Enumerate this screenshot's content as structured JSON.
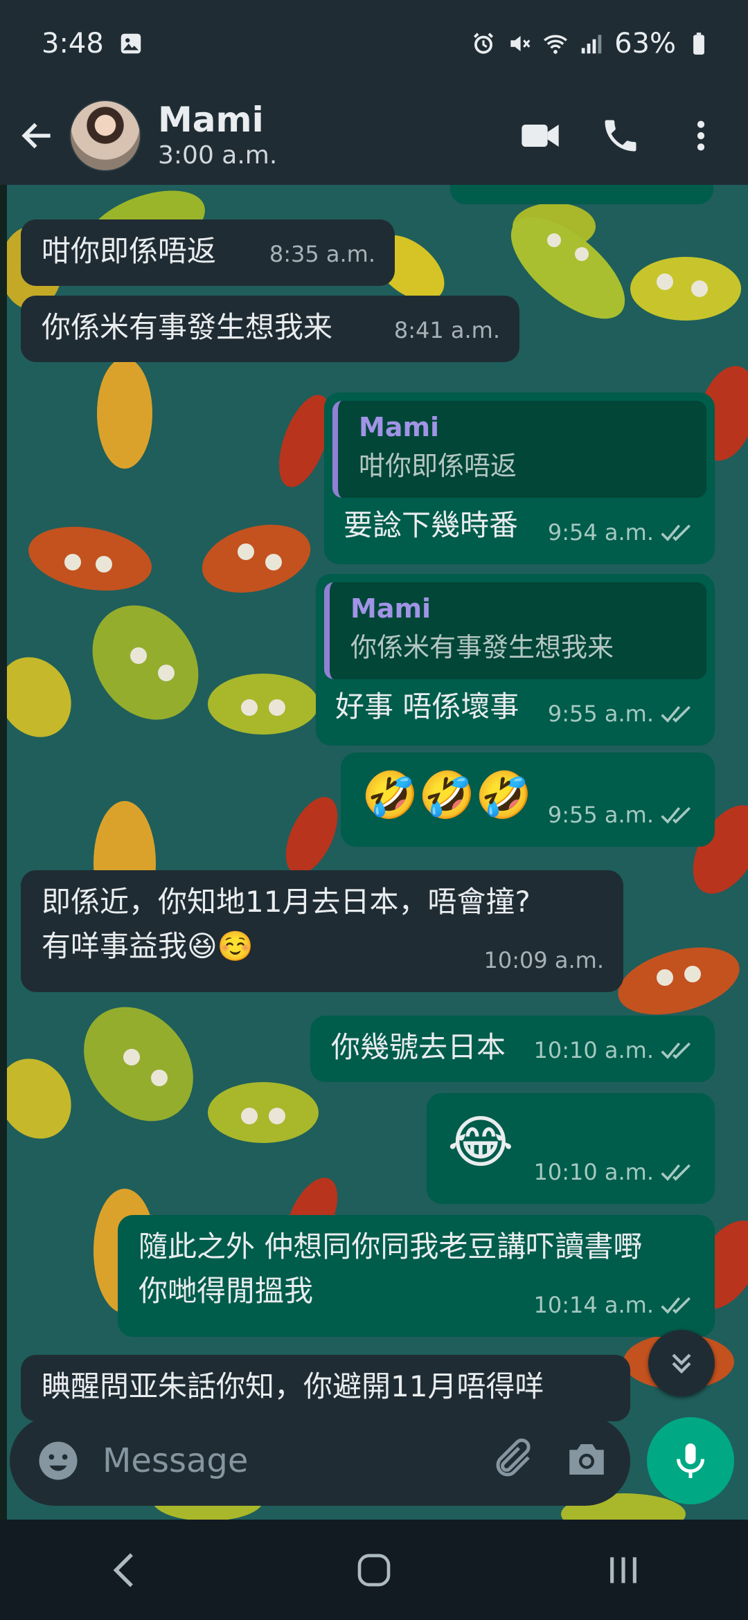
{
  "status_bar": {
    "time": "3:48",
    "battery": "63%"
  },
  "header": {
    "contact_name": "Mami",
    "last_seen": "3:00 a.m."
  },
  "messages": [
    {
      "dir": "in",
      "text": "咁你即係唔返",
      "time": "8:35 a.m."
    },
    {
      "dir": "in",
      "text": "你係米有事發生想我来",
      "time": "8:41 a.m."
    },
    {
      "dir": "out",
      "reply_name": "Mami",
      "reply_text": "咁你即係唔返",
      "text": "要諗下幾時番",
      "time": "9:54 a.m."
    },
    {
      "dir": "out",
      "reply_name": "Mami",
      "reply_text": "你係米有事發生想我来",
      "text": "好事 唔係壞事",
      "time": "9:55 a.m."
    },
    {
      "dir": "out",
      "text": "🤣🤣🤣",
      "time": "9:55 a.m."
    },
    {
      "dir": "in",
      "line1": "即係近，你知地11月去日本，唔會撞?",
      "line2": "有咩事益我😆☺️",
      "time": "10:09 a.m."
    },
    {
      "dir": "out",
      "text": "你幾號去日本",
      "time": "10:10 a.m."
    },
    {
      "dir": "out",
      "text": "😂",
      "time": "10:10 a.m."
    },
    {
      "dir": "out",
      "line1": "隨此之外 仲想同你同我老豆講吓讀書嘢",
      "line2": "你哋得閒搵我",
      "time": "10:14 a.m."
    },
    {
      "dir": "in",
      "text": "睓醒問亚朱話你知，你避開11月唔得咩",
      "time": ""
    }
  ],
  "composer": {
    "placeholder": "Message"
  },
  "icons": {
    "back": "arrow-left-icon",
    "video": "video-camera-icon",
    "call": "phone-icon",
    "menu": "more-vertical-icon",
    "emoji": "smiley-icon",
    "attach": "paperclip-icon",
    "camera": "camera-icon",
    "mic": "microphone-icon",
    "scroll": "double-chevron-down-icon"
  },
  "colors": {
    "header": "#1f2c34",
    "incoming": "#202c33",
    "outgoing": "#005c4b",
    "accent": "#00a884",
    "quote_name": "#a194e6"
  }
}
